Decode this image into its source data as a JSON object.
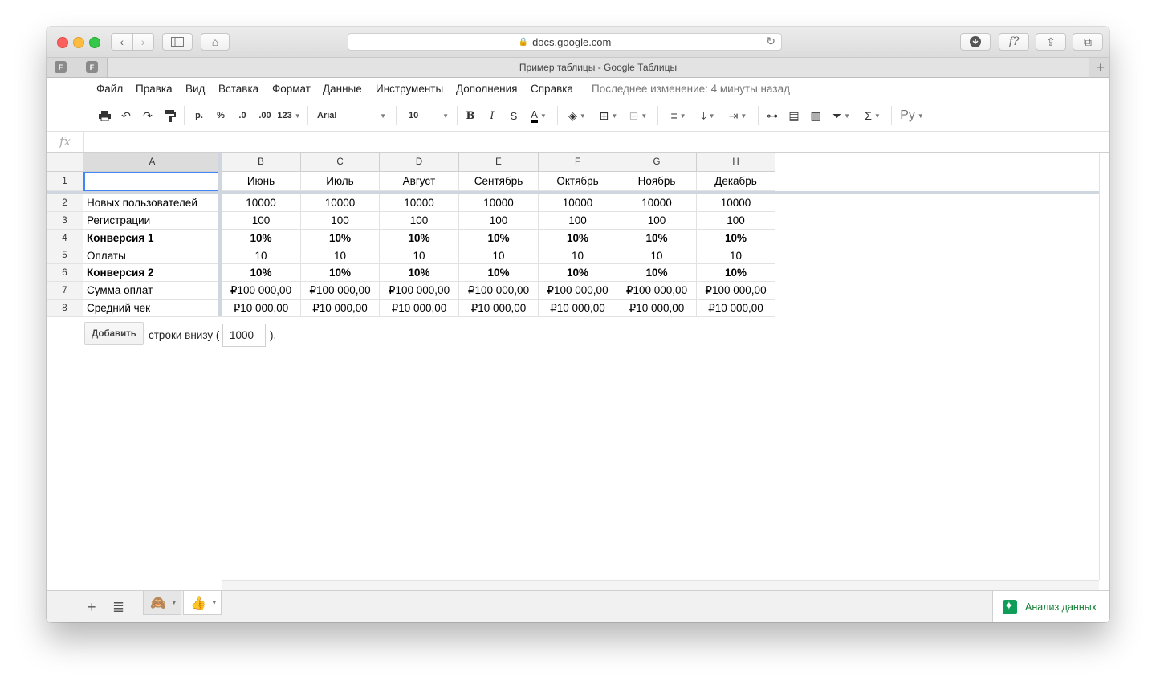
{
  "browser": {
    "url": "docs.google.com",
    "tab_title": "Пример таблицы - Google Таблицы",
    "pinned_tabs": [
      "F",
      "F"
    ]
  },
  "menu": {
    "items": [
      "Файл",
      "Правка",
      "Вид",
      "Вставка",
      "Формат",
      "Данные",
      "Инструменты",
      "Дополнения",
      "Справка"
    ],
    "last_edit": "Последнее изменение: 4 минуты назад"
  },
  "toolbar": {
    "currency": "р.",
    "percent": "%",
    "dec_decrease": ".0",
    "dec_increase": ".00",
    "more_formats": "123",
    "font": "Arial",
    "font_size": "10",
    "bold": "B",
    "italic": "I",
    "strike": "S",
    "text_color": "A",
    "input_tools": "Ру"
  },
  "formula_bar": {
    "fx": "fx",
    "value": ""
  },
  "sheet": {
    "columns": [
      "A",
      "B",
      "C",
      "D",
      "E",
      "F",
      "G",
      "H"
    ],
    "rows": [
      {
        "num": "1",
        "cells": [
          "",
          "Июнь",
          "Июль",
          "Август",
          "Сентябрь",
          "Октябрь",
          "Ноябрь",
          "Декабрь"
        ],
        "bold": false
      },
      {
        "num": "2",
        "cells": [
          "Новых пользователей",
          "10000",
          "10000",
          "10000",
          "10000",
          "10000",
          "10000",
          "10000"
        ],
        "bold": false
      },
      {
        "num": "3",
        "cells": [
          "Регистрации",
          "100",
          "100",
          "100",
          "100",
          "100",
          "100",
          "100"
        ],
        "bold": false
      },
      {
        "num": "4",
        "cells": [
          "Конверсия 1",
          "10%",
          "10%",
          "10%",
          "10%",
          "10%",
          "10%",
          "10%"
        ],
        "bold": true
      },
      {
        "num": "5",
        "cells": [
          "Оплаты",
          "10",
          "10",
          "10",
          "10",
          "10",
          "10",
          "10"
        ],
        "bold": false
      },
      {
        "num": "6",
        "cells": [
          "Конверсия 2",
          "10%",
          "10%",
          "10%",
          "10%",
          "10%",
          "10%",
          "10%"
        ],
        "bold": true
      },
      {
        "num": "7",
        "cells": [
          "Сумма оплат",
          "₽100 000,00",
          "₽100 000,00",
          "₽100 000,00",
          "₽100 000,00",
          "₽100 000,00",
          "₽100 000,00",
          "₽100 000,00"
        ],
        "bold": false
      },
      {
        "num": "8",
        "cells": [
          "Средний чек",
          "₽10 000,00",
          "₽10 000,00",
          "₽10 000,00",
          "₽10 000,00",
          "₽10 000,00",
          "₽10 000,00",
          "₽10 000,00"
        ],
        "bold": false
      }
    ]
  },
  "add_rows": {
    "button": "Добавить",
    "text": "строки внизу (",
    "value": "1000",
    "end": ")."
  },
  "sheet_tabs": [
    "🙈",
    "👍"
  ],
  "explore": {
    "label": "Анализ данных"
  },
  "colors": {
    "selection": "#4285f4",
    "explore": "#0f9d58"
  }
}
